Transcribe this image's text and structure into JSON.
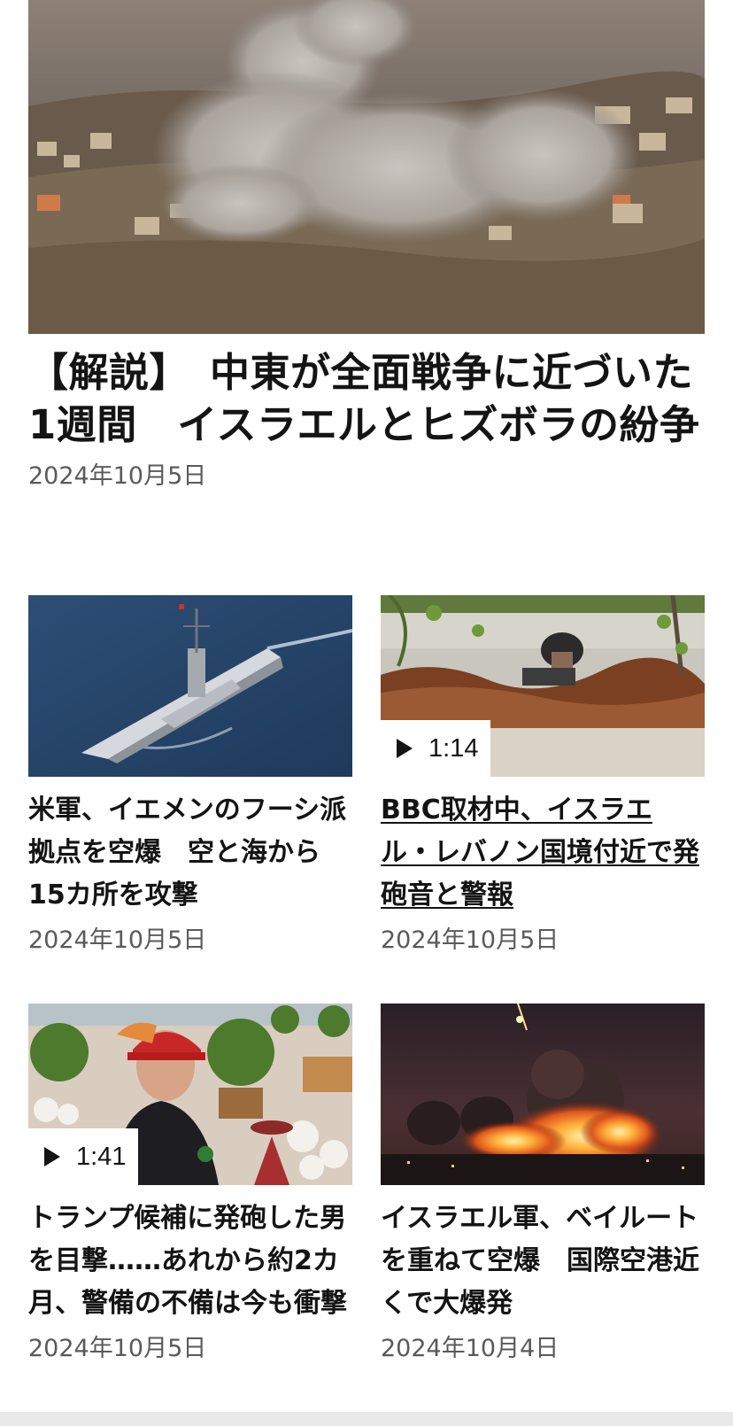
{
  "hero": {
    "title": "【解説】　中東が全面戦争に近づいた1週間　イスラエルとヒズボラの紛争",
    "date": "2024年10月5日",
    "image_icon": "airstrike-smoke-photo"
  },
  "cards": [
    {
      "title": "米軍、イエメンのフーシ派拠点を空爆　空と海から15カ所を攻撃",
      "date": "2024年10月5日",
      "image_icon": "warship-photo",
      "is_video": false
    },
    {
      "title": "BBC取材中、イスラエル・レバノン国境付近で発砲音と警報",
      "date": "2024年10月5日",
      "image_icon": "journalist-helmet-photo",
      "is_video": true,
      "duration": "1:14"
    },
    {
      "title": "トランプ候補に発砲した男を目撃……あれから約2カ月、警備の不備は今も衝撃",
      "date": "2024年10月5日",
      "image_icon": "man-red-cap-photo",
      "is_video": true,
      "duration": "1:41"
    },
    {
      "title": "イスラエル軍、ベイルートを重ねて空爆　国際空港近くで大爆発",
      "date": "2024年10月4日",
      "image_icon": "night-explosion-photo",
      "is_video": false
    }
  ],
  "colors": {
    "text": "#141414",
    "date": "#5a5a5a",
    "background": "#ffffff"
  }
}
